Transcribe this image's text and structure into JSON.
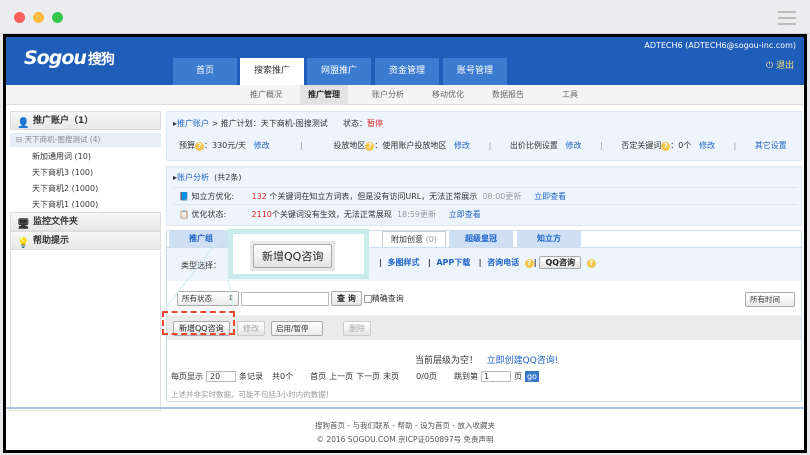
{
  "window": {
    "controls": [
      "close",
      "minimize",
      "maximize"
    ]
  },
  "header": {
    "logo": "Sogou搜狗",
    "user": "ADTECH6 (ADTECH6@sogou-inc.com)",
    "logout": "退出",
    "tabs": [
      "首页",
      "搜索推广",
      "网盟推广",
      "资金管理",
      "账号管理"
    ],
    "subnav": [
      "推广概况",
      "推广管理",
      "账户分析",
      "移动优化",
      "数据报告",
      "工具"
    ]
  },
  "sidebar": {
    "account_header": "推广账户（1）",
    "account": "天下商机-图搜测试 (4)",
    "plans": [
      "新加通用词 (10)",
      "天下商机3 (100)",
      "天下商机2 (1000)",
      "天下商机1 (1000)"
    ],
    "monitor": "监控文件夹",
    "help": "帮助提示"
  },
  "plan": {
    "breadcrumb_root": "推广账户",
    "breadcrumb_rest": "> 推广计划：天下商机-图搜测试",
    "status_label": "状态：",
    "status": "暂停",
    "budget_label": "预算",
    "budget": "：330元/天",
    "region_label": "投放地区",
    "region": "：使用账户投放地区",
    "bid_label": "出价比例设置",
    "neg_label": "否定关键词",
    "neg": "：0个",
    "edit": "修改",
    "other": "其它设置"
  },
  "analysis": {
    "title": "账户分析",
    "count": "(共2条)",
    "rows": [
      {
        "label": "知立方优化:",
        "num": "132",
        "text": " 个关键词在知立方词表，但是没有访问URL，无法正常展示",
        "time": "08:00更新",
        "link": "立即查看"
      },
      {
        "label": "优化状态:",
        "num": "2110",
        "text": "个关键词没有生效，无法正常展现",
        "time": "18:59更新",
        "link": "立即查看"
      }
    ]
  },
  "tabs": [
    "推广组",
    "附加创意",
    "超级皇冠",
    "知立方"
  ],
  "tab_count": "(0)",
  "type_row": {
    "label": "类型选择：",
    "options": [
      "多图样式",
      "APP下载",
      "咨询电话"
    ],
    "qq_button": "QQ咨询"
  },
  "filter": {
    "status": "所有状态",
    "query": "查 询",
    "exact": "精确查询",
    "time": "所有时间"
  },
  "actions": {
    "add": "新增QQ咨询",
    "edit": "修改",
    "toggle": "启用/暂停",
    "delete": "删除"
  },
  "callout": {
    "label": "新增QQ咨询"
  },
  "empty": {
    "text": "当前层级为空！",
    "link": "立即创建QQ咨询!"
  },
  "pager": {
    "per_page": "每页显示",
    "size": "20",
    "records": "条记录",
    "total": "共0个",
    "first": "首页",
    "prev": "上一页",
    "next": "下一页",
    "last": "末页",
    "pages": "0/0页",
    "jump": "跳到第",
    "page": "1",
    "page_unit": "页",
    "go": "go"
  },
  "note": "上述并非实时数据，可能不包括3小时内的数据！",
  "footer": {
    "links": "搜狗首页 - 与我们联系 - 帮助 - 设为首页 - 放入收藏夹",
    "copyright": "© 2016 SOGOU.COM 京ICP证050897号 免责声明"
  }
}
